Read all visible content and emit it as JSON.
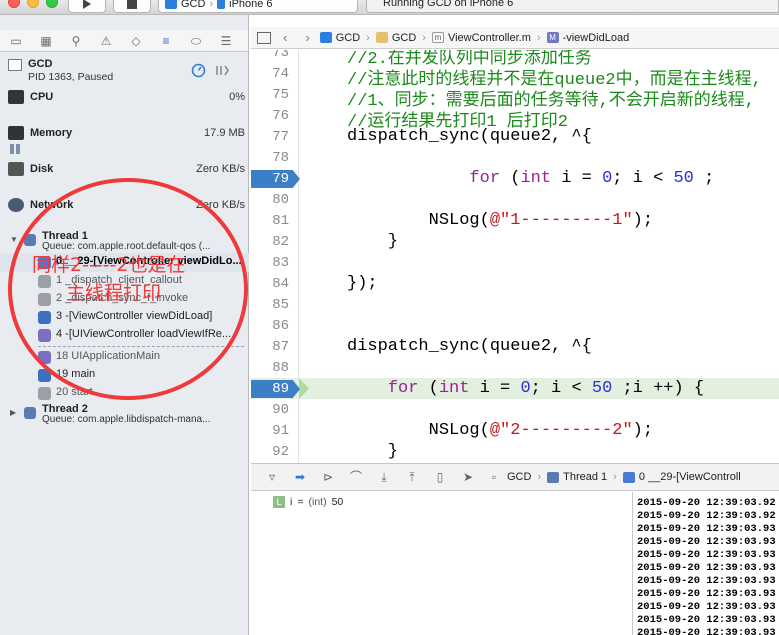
{
  "toolbar": {
    "scheme_project": "GCD",
    "scheme_device": "iPhone 6",
    "activity_status": "Running GCD on iPhone 6"
  },
  "process": {
    "name": "GCD",
    "info": "PID 1363, Paused"
  },
  "gauges": {
    "cpu_label": "CPU",
    "cpu_value": "0%",
    "memory_label": "Memory",
    "memory_value": "17.9 MB",
    "disk_label": "Disk",
    "disk_value": "Zero KB/s",
    "network_label": "Network",
    "network_value": "Zero KB/s"
  },
  "threads": [
    {
      "name": "Thread 1",
      "queue": "Queue: com.apple.root.default-qos (..."
    },
    {
      "name": "Thread 2",
      "queue": "Queue: com.apple.libdispatch-mana..."
    }
  ],
  "frames": [
    "0 __29-[ViewController viewDidLo...",
    "1 _dispatch_client_callout",
    "2 _dispatch_sync_f_invoke",
    "3 -[ViewController viewDidLoad]",
    "4 -[UIViewController loadViewIfRe...",
    "18 UIApplicationMain",
    "19 main",
    "20 start"
  ],
  "annotation": {
    "line1": "同样2-----2也是在",
    "line2": "主线程打印",
    "color": "#ee3a3a"
  },
  "jumpbar": {
    "crumb1": "GCD",
    "crumb2": "GCD",
    "crumb3": "ViewController.m",
    "crumb4": "-viewDidLoad"
  },
  "code": {
    "l73": "//2.在并发队列中同步添加任务",
    "l74": "//注意此时的线程并不是在queue2中，而是在主线程,",
    "l75": "//1、同步：需要后面的任务等待,不会开启新的线程,",
    "l76": "//运行结果先打印1 后打印2",
    "line_numbers": [
      "73",
      "74",
      "75",
      "76",
      "77",
      "78",
      "79",
      "80",
      "81",
      "82",
      "83",
      "84",
      "85",
      "86",
      "87",
      "88",
      "89",
      "90",
      "91",
      "92"
    ]
  },
  "debugbar": {
    "crumb1": "GCD",
    "crumb2": "Thread 1",
    "crumb3": "0 __29-[ViewControll"
  },
  "variables": {
    "badge": "L",
    "name": "i",
    "type": "(int)",
    "value": "50"
  },
  "console": {
    "lines": [
      "2015-09-20 12:39:03.92",
      "2015-09-20 12:39:03.92",
      "2015-09-20 12:39:03.93",
      "2015-09-20 12:39:03.93",
      "2015-09-20 12:39:03.93",
      "2015-09-20 12:39:03.93",
      "2015-09-20 12:39:03.93",
      "2015-09-20 12:39:03.93",
      "2015-09-20 12:39:03.93",
      "2015-09-20 12:39:03.93",
      "2015-09-20 12:39:03.93",
      "2015-09-20 12:39:03.93"
    ]
  }
}
